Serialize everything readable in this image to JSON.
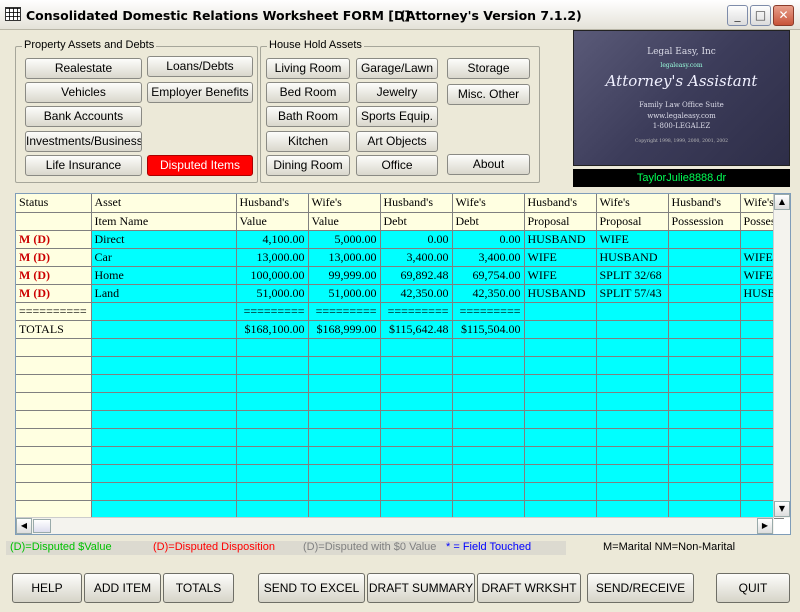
{
  "window": {
    "title": "Consolidated Domestic Relations Worksheet  FORM [D]",
    "version": "(Attorney's  Version 7.1.2)",
    "minimize": "_",
    "maximize": "□",
    "close": "✕"
  },
  "property_group": {
    "label": "Property Assets and Debts",
    "buttons": [
      "Realestate",
      "Loans/Debts",
      "Vehicles",
      "Employer Benefits",
      "Bank Accounts",
      "Investments/Business",
      "Life Insurance",
      "Disputed  Items"
    ]
  },
  "household_group": {
    "label": "House Hold Assets",
    "buttons": [
      "Living Room",
      "Garage/Lawn",
      "Storage",
      "Bed Room",
      "Jewelry",
      "Misc. Other",
      "Bath Room",
      "Sports Equip.",
      "Kitchen",
      "Art Objects",
      "Dining Room",
      "Office",
      "About"
    ]
  },
  "logo": {
    "company": "Legal Easy, Inc",
    "brand": "legaleasy.com",
    "product": "Attorney's Assistant",
    "suite": "Family Law Office Suite",
    "url": "www.legaleasy.com",
    "phone": "1-800-LEGALEZ",
    "copyright": "Copyright 1998, 1999, 2000, 2001, 2002",
    "filename": "TaylorJulie8888.dr"
  },
  "grid": {
    "header1": [
      "Status",
      "Asset",
      "Husband's",
      "Wife's",
      "Husband's",
      "Wife's",
      "Husband's",
      "Wife's",
      "Husband's",
      "Wife's"
    ],
    "header2": [
      "",
      "Item Name",
      "Value",
      "Value",
      "Debt",
      "Debt",
      "Proposal",
      "Proposal",
      "Possession",
      "Possess"
    ],
    "rows": [
      [
        "M  (D)",
        "Direct",
        "4,100.00",
        "5,000.00",
        "0.00",
        "0.00",
        "HUSBAND",
        "WIFE",
        "",
        ""
      ],
      [
        "M  (D)",
        "Car",
        "13,000.00",
        "13,000.00",
        "3,400.00",
        "3,400.00",
        "WIFE",
        "HUSBAND",
        "",
        "WIFE"
      ],
      [
        "M  (D)",
        "Home",
        "100,000.00",
        "99,999.00",
        "69,892.48",
        "69,754.00",
        "WIFE",
        "SPLIT 32/68",
        "",
        "WIFE"
      ],
      [
        "M  (D)",
        "Land",
        "51,000.00",
        "51,000.00",
        "42,350.00",
        "42,350.00",
        "HUSBAND",
        "SPLIT 57/43",
        "",
        "HUSB"
      ],
      [
        "==========",
        "",
        "=========",
        "=========",
        "=========",
        "=========",
        "",
        "",
        "",
        ""
      ],
      [
        "TOTALS",
        "",
        "$168,100.00",
        "$168,999.00",
        "$115,642.48",
        "$115,504.00",
        "",
        "",
        "",
        ""
      ]
    ],
    "empty_rows": 10
  },
  "legend": {
    "disputed_value": "(D)=Disputed $Value",
    "disputed_disposition": "(D)=Disputed Disposition",
    "disputed_zero": "(D)=Disputed with $0 Value",
    "field_touched": "*  = Field Touched",
    "marital": "M=Marital NM=Non-Marital"
  },
  "colors": {
    "disputed_value": "#00c000",
    "disputed_disposition": "#ff0000",
    "disputed_zero": "#808080",
    "field_touched": "#0000ff"
  },
  "actions": [
    "HELP",
    "ADD ITEM",
    "TOTALS",
    "SEND TO  EXCEL",
    "DRAFT SUMMARY",
    "DRAFT WRKSHT",
    "SEND/RECEIVE",
    "QUIT"
  ]
}
